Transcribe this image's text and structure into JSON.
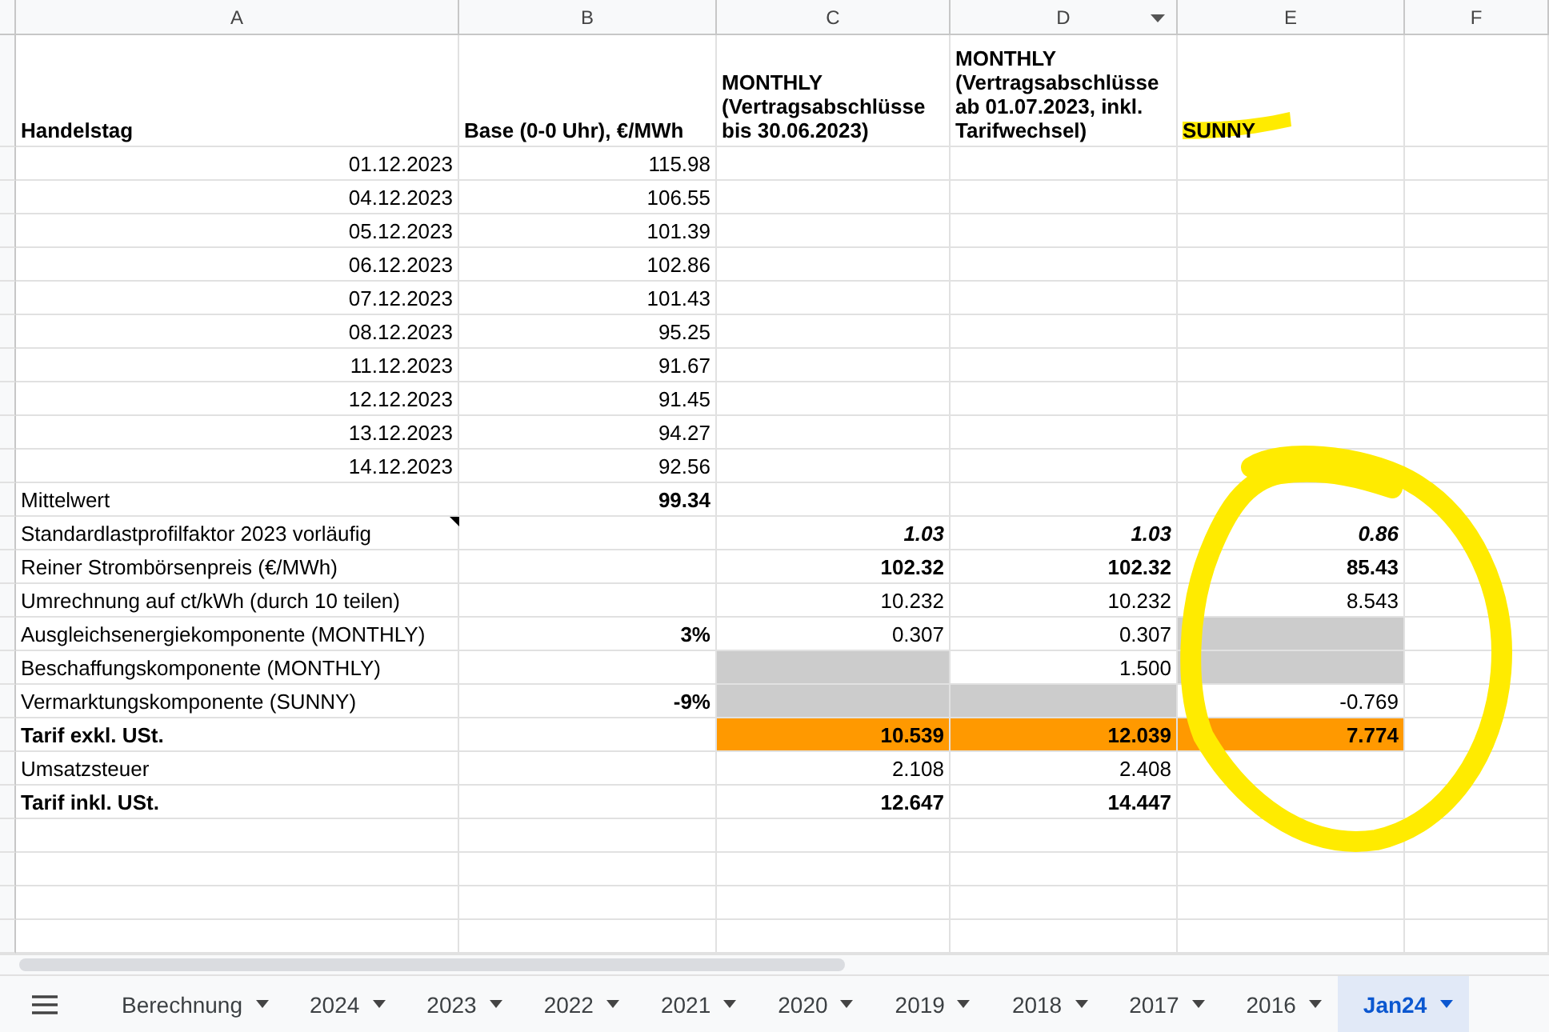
{
  "columns": [
    {
      "letter": "A",
      "filter": false
    },
    {
      "letter": "B",
      "filter": false
    },
    {
      "letter": "C",
      "filter": false
    },
    {
      "letter": "D",
      "filter": true
    },
    {
      "letter": "E",
      "filter": false
    },
    {
      "letter": "F",
      "filter": false
    }
  ],
  "header_row": [
    "Handelstag",
    "Base (0-0 Uhr), €/MWh",
    "MONTHLY (Vertragsabschlüsse bis 30.06.2023)",
    "MONTHLY (Vertragsabschlüsse ab 01.07.2023, inkl. Tarifwechsel)",
    "SUNNY"
  ],
  "rows": [
    {
      "cells": [
        {
          "text": "01.12.2023",
          "kind": "number"
        },
        {
          "text": "115.98",
          "kind": "number"
        },
        null,
        null,
        null,
        null
      ]
    },
    {
      "cells": [
        {
          "text": "04.12.2023",
          "kind": "number"
        },
        {
          "text": "106.55",
          "kind": "number"
        },
        null,
        null,
        null,
        null
      ]
    },
    {
      "cells": [
        {
          "text": "05.12.2023",
          "kind": "number"
        },
        {
          "text": "101.39",
          "kind": "number"
        },
        null,
        null,
        null,
        null
      ]
    },
    {
      "cells": [
        {
          "text": "06.12.2023",
          "kind": "number"
        },
        {
          "text": "102.86",
          "kind": "number"
        },
        null,
        null,
        null,
        null
      ]
    },
    {
      "cells": [
        {
          "text": "07.12.2023",
          "kind": "number"
        },
        {
          "text": "101.43",
          "kind": "number"
        },
        null,
        null,
        null,
        null
      ]
    },
    {
      "cells": [
        {
          "text": "08.12.2023",
          "kind": "number"
        },
        {
          "text": "95.25",
          "kind": "number"
        },
        null,
        null,
        null,
        null
      ]
    },
    {
      "cells": [
        {
          "text": "11.12.2023",
          "kind": "number"
        },
        {
          "text": "91.67",
          "kind": "number"
        },
        null,
        null,
        null,
        null
      ]
    },
    {
      "cells": [
        {
          "text": "12.12.2023",
          "kind": "number"
        },
        {
          "text": "91.45",
          "kind": "number"
        },
        null,
        null,
        null,
        null
      ]
    },
    {
      "cells": [
        {
          "text": "13.12.2023",
          "kind": "number"
        },
        {
          "text": "94.27",
          "kind": "number"
        },
        null,
        null,
        null,
        null
      ]
    },
    {
      "cells": [
        {
          "text": "14.12.2023",
          "kind": "number"
        },
        {
          "text": "92.56",
          "kind": "number"
        },
        null,
        null,
        null,
        null
      ]
    },
    {
      "cells": [
        {
          "text": "Mittelwert",
          "kind": "label"
        },
        {
          "text": "99.34",
          "kind": "bold-number"
        },
        null,
        null,
        null,
        null
      ]
    },
    {
      "cells": [
        {
          "text": "Standardlastprofilfaktor 2023 vorläufig",
          "kind": "label",
          "note": true
        },
        null,
        {
          "text": "1.03",
          "kind": "bold-italic-number"
        },
        {
          "text": "1.03",
          "kind": "bold-italic-number"
        },
        {
          "text": "0.86",
          "kind": "bold-italic-number"
        },
        null
      ]
    },
    {
      "cells": [
        {
          "text": "Reiner Strombörsenpreis (€/MWh)",
          "kind": "label"
        },
        null,
        {
          "text": "102.32",
          "kind": "bold-number"
        },
        {
          "text": "102.32",
          "kind": "bold-number"
        },
        {
          "text": "85.43",
          "kind": "bold-number"
        },
        null
      ]
    },
    {
      "cells": [
        {
          "text": "Umrechnung auf ct/kWh (durch 10 teilen)",
          "kind": "label"
        },
        null,
        {
          "text": "10.232",
          "kind": "number"
        },
        {
          "text": "10.232",
          "kind": "number"
        },
        {
          "text": "8.543",
          "kind": "number"
        },
        null
      ]
    },
    {
      "cells": [
        {
          "text": "Ausgleichsenergiekomponente (MONTHLY)",
          "kind": "label"
        },
        {
          "text": "3%",
          "kind": "bold-number"
        },
        {
          "text": "0.307",
          "kind": "number"
        },
        {
          "text": "0.307",
          "kind": "number"
        },
        {
          "color": "#cccccc"
        },
        null
      ]
    },
    {
      "cells": [
        {
          "text": "Beschaffungskomponente (MONTHLY)",
          "kind": "label"
        },
        null,
        {
          "color": "#cccccc"
        },
        {
          "text": "1.500",
          "kind": "number"
        },
        {
          "color": "#cccccc"
        },
        null
      ]
    },
    {
      "cells": [
        {
          "text": "Vermarktungskomponente (SUNNY)",
          "kind": "label"
        },
        {
          "text": "-9%",
          "kind": "bold-number"
        },
        {
          "color": "#cccccc"
        },
        {
          "color": "#cccccc"
        },
        {
          "text": "-0.769",
          "kind": "number"
        },
        null
      ]
    },
    {
      "cells": [
        {
          "text": "Tarif exkl. USt.",
          "kind": "bold-label"
        },
        null,
        {
          "text": "10.539",
          "kind": "bold-number",
          "color": "#ff9900"
        },
        {
          "text": "12.039",
          "kind": "bold-number",
          "color": "#ff9900"
        },
        {
          "text": "7.774",
          "kind": "bold-number",
          "color": "#ff9900"
        },
        null
      ]
    },
    {
      "cells": [
        {
          "text": "Umsatzsteuer",
          "kind": "label"
        },
        null,
        {
          "text": "2.108",
          "kind": "number"
        },
        {
          "text": "2.408",
          "kind": "number"
        },
        null,
        null
      ]
    },
    {
      "cells": [
        {
          "text": "Tarif inkl. USt.",
          "kind": "bold-label"
        },
        null,
        {
          "text": "12.647",
          "kind": "bold-number"
        },
        {
          "text": "14.447",
          "kind": "bold-number"
        },
        null,
        null
      ]
    }
  ],
  "sheet_tabs": [
    {
      "label": "Berechnung",
      "selected": false
    },
    {
      "label": "2024",
      "selected": false
    },
    {
      "label": "2023",
      "selected": false
    },
    {
      "label": "2022",
      "selected": false
    },
    {
      "label": "2021",
      "selected": false
    },
    {
      "label": "2020",
      "selected": false
    },
    {
      "label": "2019",
      "selected": false
    },
    {
      "label": "2018",
      "selected": false
    },
    {
      "label": "2017",
      "selected": false
    },
    {
      "label": "2016",
      "selected": false
    },
    {
      "label": "Jan24",
      "selected": true
    }
  ]
}
